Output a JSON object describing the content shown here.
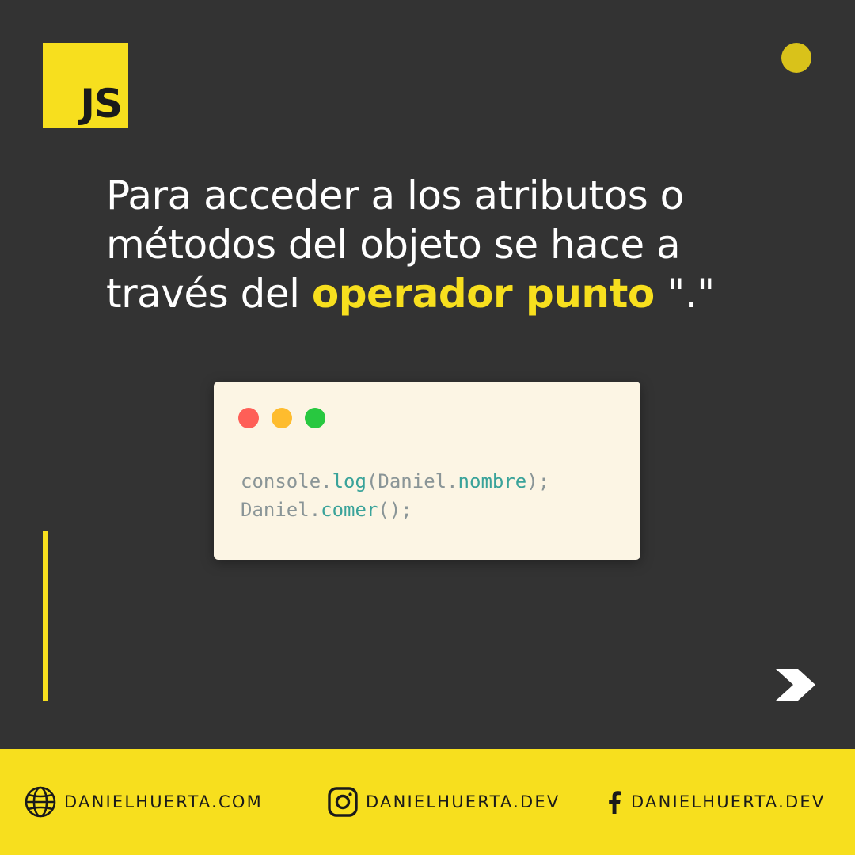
{
  "logo": {
    "text": "JS"
  },
  "headline": {
    "line1": "Para acceder a los atributos o",
    "line2": "métodos del objeto se hace a",
    "line3_prefix": "través del ",
    "line3_highlight": "operador punto",
    "line3_suffix": " \".\""
  },
  "code_window": {
    "buttons": [
      "close",
      "minimize",
      "maximize"
    ],
    "lines": [
      [
        {
          "text": "console.",
          "color": "plain"
        },
        {
          "text": "log",
          "color": "teal"
        },
        {
          "text": "(Daniel.",
          "color": "plain"
        },
        {
          "text": "nombre",
          "color": "teal"
        },
        {
          "text": ");",
          "color": "plain"
        }
      ],
      [
        {
          "text": "Daniel.",
          "color": "plain"
        },
        {
          "text": "comer",
          "color": "teal"
        },
        {
          "text": "();",
          "color": "plain"
        }
      ]
    ]
  },
  "footer": {
    "website": {
      "icon": "globe-icon",
      "label": "DANIELHUERTA.COM"
    },
    "instagram": {
      "icon": "instagram-icon",
      "label": "DANIELHUERTA.DEV"
    },
    "facebook": {
      "icon": "facebook-icon",
      "label": "DANIELHUERTA.DEV"
    }
  },
  "colors": {
    "background": "#333333",
    "accent": "#f7df1e",
    "code_bg": "#fcf5e4",
    "code_plain": "#8a9597",
    "code_teal": "#3aa39a"
  }
}
